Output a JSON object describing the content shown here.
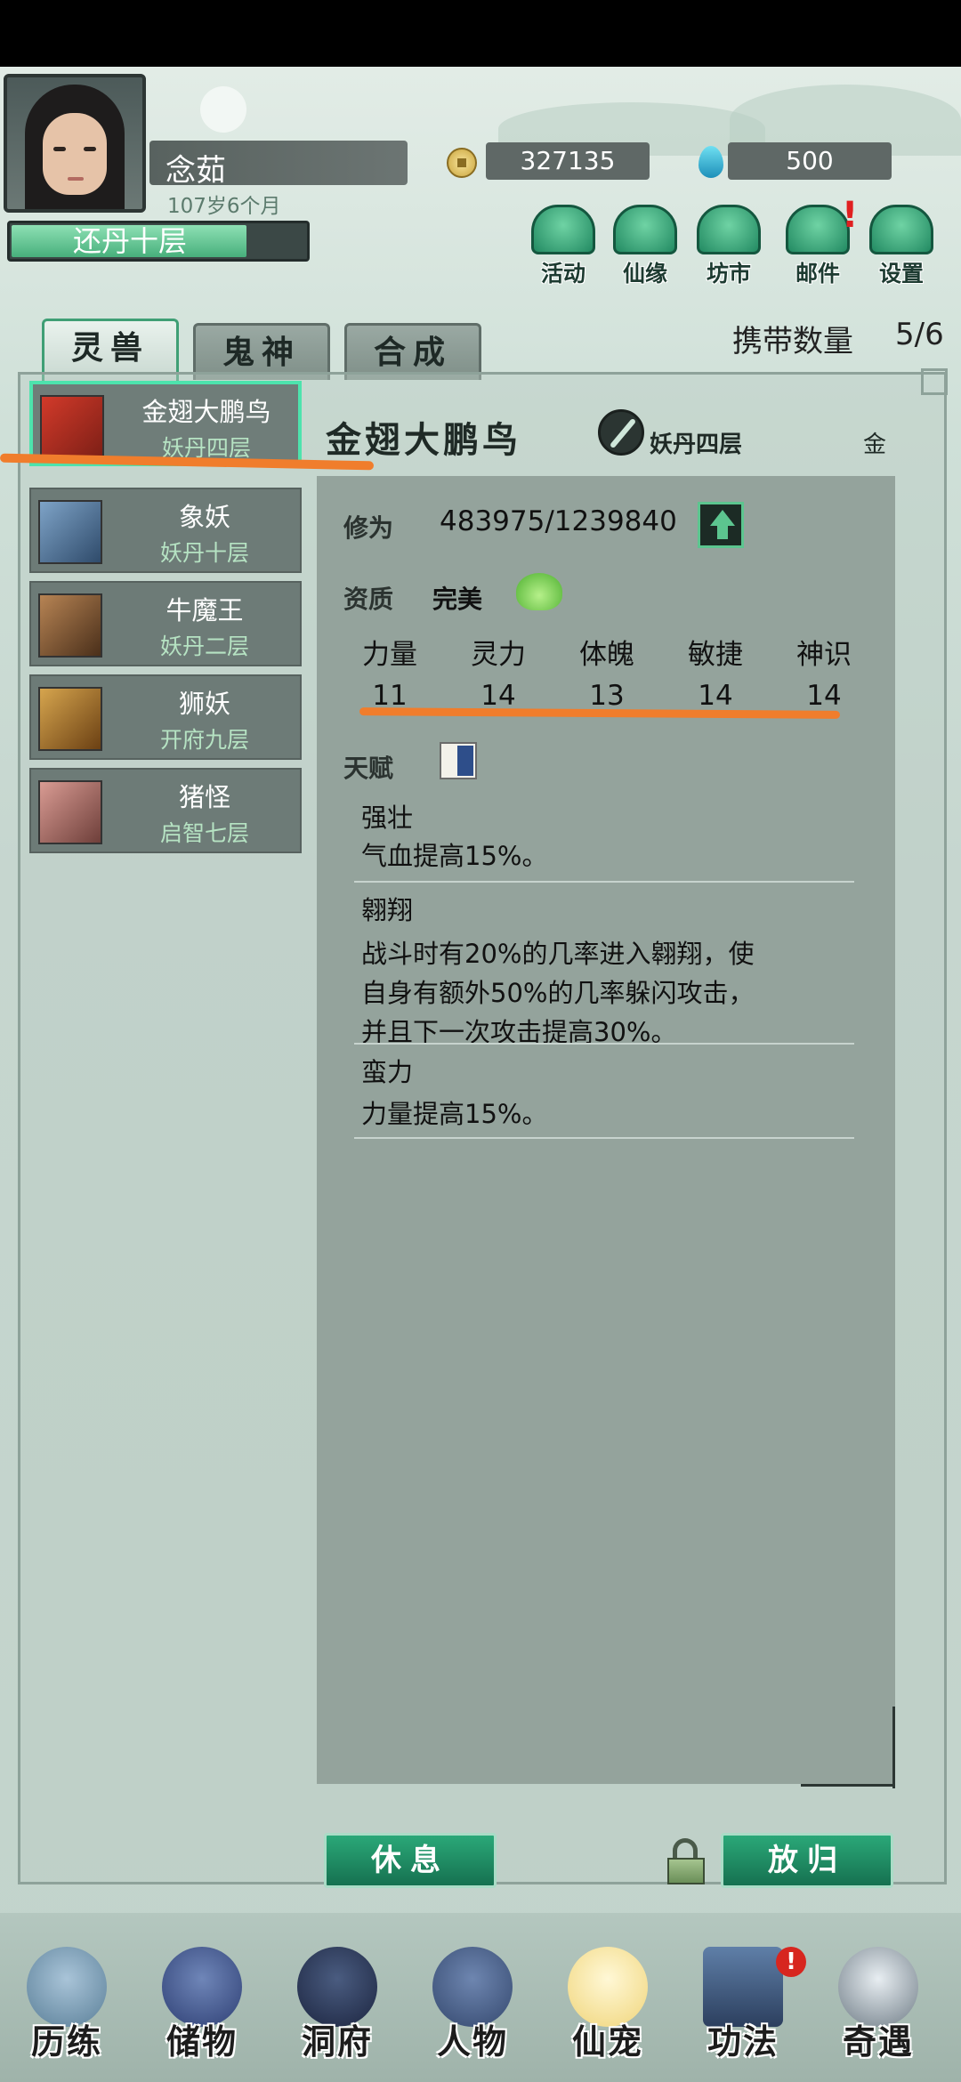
{
  "player": {
    "name": "念茹",
    "age": "107岁6个月",
    "realm": "还丹十层",
    "realm_progress": 0.8,
    "coins": "327135",
    "gems": "500"
  },
  "top_buttons": [
    {
      "label": "活动",
      "icon": "event-icon"
    },
    {
      "label": "仙缘",
      "icon": "fate-icon"
    },
    {
      "label": "坊市",
      "icon": "market-icon"
    },
    {
      "label": "邮件",
      "icon": "mail-icon"
    },
    {
      "label": "设置",
      "icon": "gear-icon"
    }
  ],
  "tabs": [
    "灵兽",
    "鬼神",
    "合成"
  ],
  "carry": {
    "label": "携带数量",
    "value": "5/6"
  },
  "beasts": [
    {
      "name": "金翅大鹏鸟",
      "level": "妖丹四层"
    },
    {
      "name": "象妖",
      "level": "妖丹十层"
    },
    {
      "name": "牛魔王",
      "level": "妖丹二层"
    },
    {
      "name": "狮妖",
      "level": "开府九层"
    },
    {
      "name": "猪怪",
      "level": "启智七层"
    }
  ],
  "detail": {
    "title": "金翅大鹏鸟",
    "rank": "妖丹四层",
    "element": "金",
    "cultivation_label": "修为",
    "cultivation_value": "483975/1239840",
    "aptitude_label": "资质",
    "aptitude_value": "完美",
    "stats": [
      {
        "name": "力量",
        "value": "11"
      },
      {
        "name": "灵力",
        "value": "14"
      },
      {
        "name": "体魄",
        "value": "13"
      },
      {
        "name": "敏捷",
        "value": "14"
      },
      {
        "name": "神识",
        "value": "14"
      }
    ],
    "talent_label": "天赋",
    "talents": [
      {
        "name": "强壮",
        "desc": [
          "气血提高15%。"
        ]
      },
      {
        "name": "翱翔",
        "desc": [
          "战斗时有20%的几率进入翱翔，使",
          "自身有额外50%的几率躲闪攻击，",
          "并且下一次攻击提高30%。"
        ]
      },
      {
        "name": "蛮力",
        "desc": [
          "力量提高15%。"
        ]
      }
    ]
  },
  "actions": {
    "rest": "休息",
    "release": "放归"
  },
  "bottom_nav": [
    {
      "label": "历练"
    },
    {
      "label": "储物"
    },
    {
      "label": "洞府"
    },
    {
      "label": "人物"
    },
    {
      "label": "仙宠"
    },
    {
      "label": "功法"
    },
    {
      "label": "奇遇"
    }
  ],
  "nav_alert": "!"
}
